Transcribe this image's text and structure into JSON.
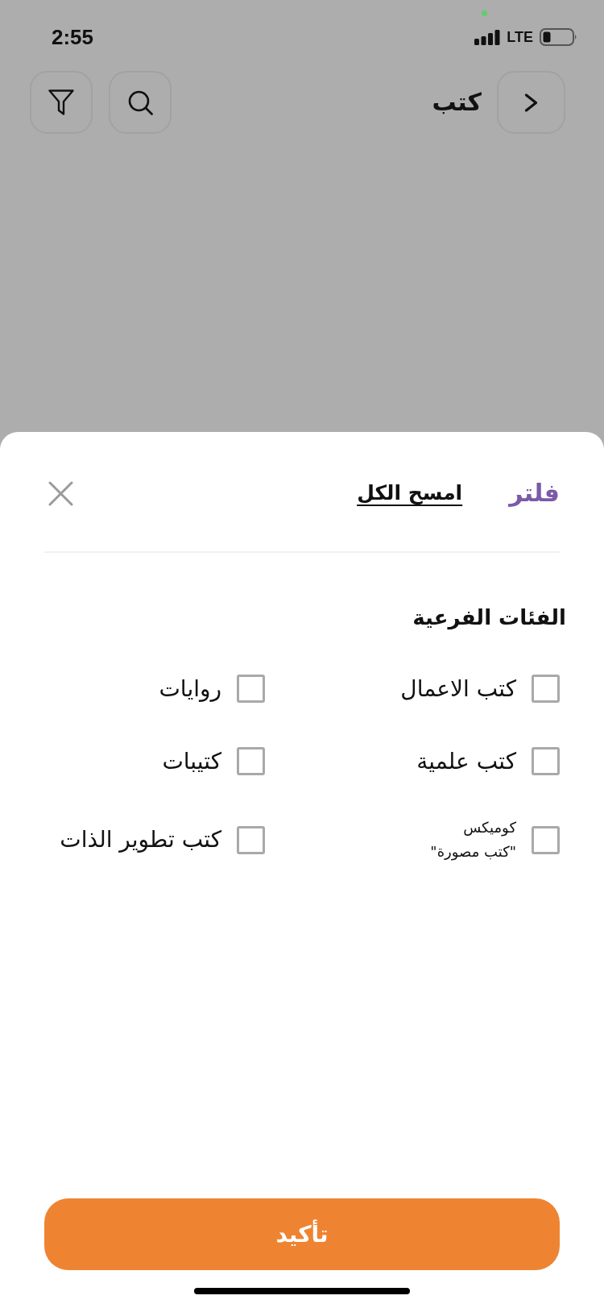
{
  "status_bar": {
    "time": "2:55",
    "network": "LTE"
  },
  "header": {
    "title": "كتب"
  },
  "filter_sheet": {
    "title": "فلتر",
    "clear_all": "امسح الكل",
    "section_title": "الفئات الفرعية",
    "options": [
      {
        "kind": "regular",
        "label": "كتب الاعمال",
        "checked": false
      },
      {
        "kind": "regular",
        "label": "روايات",
        "checked": false
      },
      {
        "kind": "regular",
        "label": "كتب علمية",
        "checked": false
      },
      {
        "kind": "regular",
        "label": "كتيبات",
        "checked": false
      },
      {
        "kind": "stacked",
        "label": "كوميكس\n\"كتب مصورة\"",
        "checked": false
      },
      {
        "kind": "regular",
        "label": "كتب تطوير الذات",
        "checked": false
      }
    ],
    "confirm_button": "تأكيد"
  }
}
